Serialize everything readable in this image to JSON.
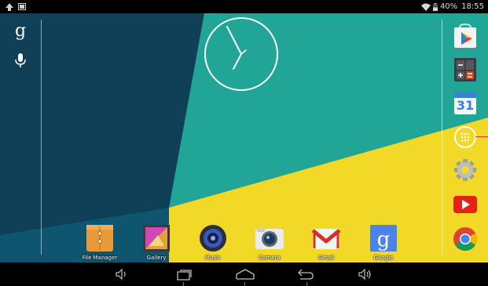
{
  "status_bar": {
    "battery_percent": "40%",
    "time": "18:55"
  },
  "icons": {
    "status_left": [
      "upload-icon",
      "screenshot-icon"
    ],
    "status_right": [
      "wifi-icon",
      "battery-icon"
    ],
    "search": [
      "google-search-icon",
      "voice-search-icon"
    ],
    "hotseat": [
      "play-store-icon",
      "calculator-icon",
      "calendar-icon",
      "all-apps-icon",
      "settings-icon",
      "youtube-icon",
      "chrome-icon"
    ],
    "nav": [
      "volume-down-icon",
      "recent-apps-icon",
      "home-icon",
      "back-icon",
      "volume-up-icon"
    ]
  },
  "calendar": {
    "day": "31"
  },
  "apps": [
    {
      "label": "File Manager",
      "icon": "file-manager-icon"
    },
    {
      "label": "Gallery",
      "icon": "gallery-icon"
    },
    {
      "label": "Music",
      "icon": "music-icon"
    },
    {
      "label": "Camera",
      "icon": "camera-icon"
    },
    {
      "label": "Gmail",
      "icon": "gmail-icon"
    },
    {
      "label": "Google",
      "icon": "google-icon"
    }
  ],
  "colors": {
    "wallpaper_dark_blue": "#0b4a63",
    "wallpaper_teal": "#21a597",
    "wallpaper_yellow": "#f2d827",
    "status_bar": "#000000",
    "nav_bar": "#000000",
    "nav_accent": "#e53935"
  }
}
